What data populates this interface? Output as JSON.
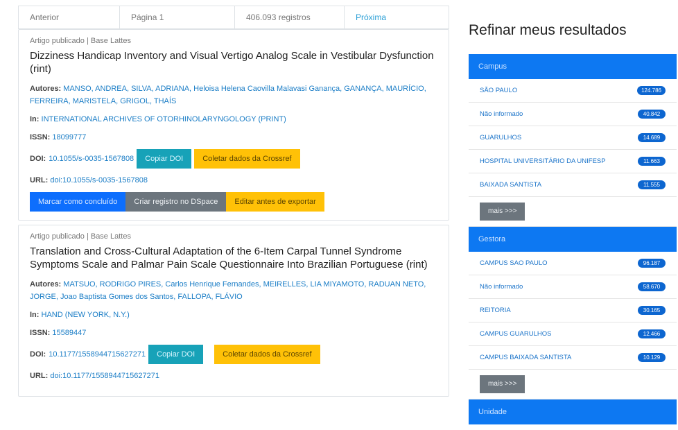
{
  "pagination": {
    "previous": "Anterior",
    "page": "Página 1",
    "records": "406.093 registros",
    "next": "Próxima"
  },
  "results": [
    {
      "type": "Artigo publicado | Base Lattes",
      "title": "Dizziness Handicap Inventory and Visual Vertigo Analog Scale in Vestibular Dysfunction (rint)",
      "authors_label": "Autores:",
      "authors": "MANSO, ANDREA, SILVA, ADRIANA, Heloisa Helena Caovilla Malavasi Ganança, GANANÇA, MAURÍCIO, FERREIRA, MARISTELA, GRIGOL, THAÍS",
      "in_label": "In:",
      "in": "INTERNATIONAL ARCHIVES OF OTORHINOLARYNGOLOGY (PRINT)",
      "issn_label": "ISSN:",
      "issn": "18099777",
      "doi_label": "DOI:",
      "doi": "10.1055/s-0035-1567808",
      "copy_doi": "Copiar DOI",
      "crossref": "Coletar dados da Crossref",
      "url_label": "URL:",
      "url": "doi:10.1055/s-0035-1567808",
      "mark_done": "Marcar como concluído",
      "create_dspace": "Criar registro no DSpace",
      "edit_export": "Editar antes de exportar"
    },
    {
      "type": "Artigo publicado | Base Lattes",
      "title": "Translation and Cross-Cultural Adaptation of the 6-Item Carpal Tunnel Syndrome Symptoms Scale and Palmar Pain Scale Questionnaire Into Brazilian Portuguese (rint)",
      "authors_label": "Autores:",
      "authors": "MATSUO, RODRIGO PIRES, Carlos Henrique Fernandes, MEIRELLES, LIA MIYAMOTO, RADUAN NETO, JORGE, Joao Baptista Gomes dos Santos, FALLOPA, FLÁVIO",
      "in_label": "In:",
      "in": "HAND (NEW YORK, N.Y.)",
      "issn_label": "ISSN:",
      "issn": "15589447",
      "doi_label": "DOI:",
      "doi": "10.1177/1558944715627271",
      "copy_doi": "Copiar DOI",
      "crossref": "Coletar dados da Crossref",
      "url_label": "URL:",
      "url": "doi:10.1177/1558944715627271"
    }
  ],
  "refine": {
    "title": "Refinar meus resultados",
    "facets": [
      {
        "name": "Campus",
        "items": [
          {
            "label": "SÃO PAULO",
            "count": "124.786"
          },
          {
            "label": "Não informado",
            "count": "40.842"
          },
          {
            "label": "GUARULHOS",
            "count": "14.689"
          },
          {
            "label": "HOSPITAL UNIVERSITÁRIO DA UNIFESP",
            "count": "11.663"
          },
          {
            "label": "BAIXADA SANTISTA",
            "count": "11.555"
          }
        ],
        "more": "mais >>>"
      },
      {
        "name": "Gestora",
        "items": [
          {
            "label": "CAMPUS SAO PAULO",
            "count": "96.187"
          },
          {
            "label": "Não informado",
            "count": "58.670"
          },
          {
            "label": "REITORIA",
            "count": "30.165"
          },
          {
            "label": "CAMPUS GUARULHOS",
            "count": "12.466"
          },
          {
            "label": "CAMPUS BAIXADA SANTISTA",
            "count": "10.129"
          }
        ],
        "more": "mais >>>"
      },
      {
        "name": "Unidade",
        "items": []
      }
    ]
  },
  "colors": {
    "primary": "#0d78f2",
    "teal": "#17a2b8",
    "yellow": "#ffc107",
    "gray": "#6c757d",
    "link": "#1a7dc6"
  }
}
